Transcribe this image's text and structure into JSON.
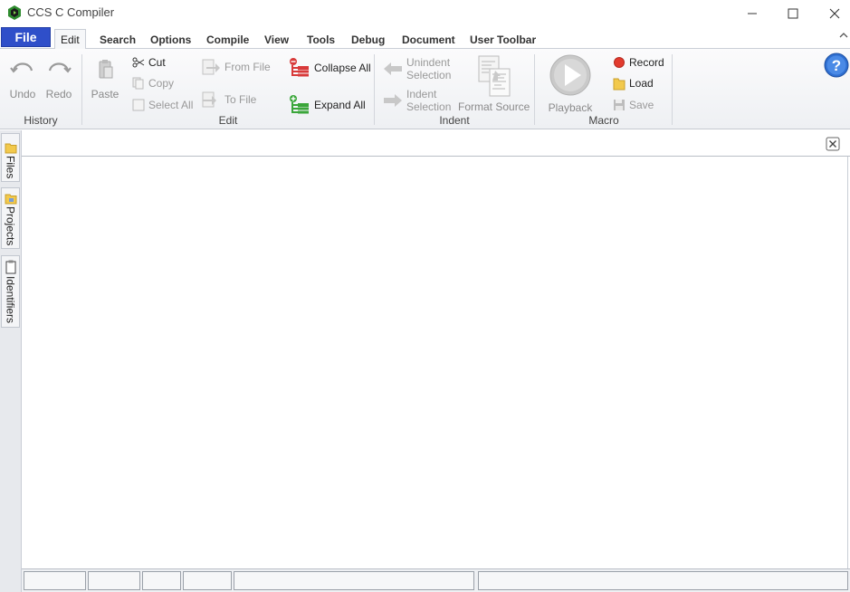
{
  "window": {
    "title": "CCS C Compiler"
  },
  "ribbon_tabs": {
    "file": "File",
    "items": [
      "Edit",
      "Search",
      "Options",
      "Compile",
      "View",
      "Tools",
      "Debug",
      "Document",
      "User Toolbar"
    ],
    "active": "Edit"
  },
  "ribbon": {
    "history": {
      "label": "History",
      "undo": "Undo",
      "redo": "Redo"
    },
    "edit": {
      "label": "Edit",
      "paste": "Paste",
      "cut": "Cut",
      "copy": "Copy",
      "select_all": "Select All",
      "from_file": "From File",
      "to_file": "To File",
      "collapse_all": "Collapse All",
      "expand_all": "Expand All"
    },
    "indent": {
      "label": "Indent",
      "unindent_line1": "Unindent",
      "unindent_line2": "Selection",
      "indent_line1": "Indent",
      "indent_line2": "Selection",
      "format_source": "Format Source"
    },
    "macro": {
      "label": "Macro",
      "playback": "Playback",
      "record": "Record",
      "load": "Load",
      "save": "Save"
    }
  },
  "dock": {
    "files": "Files",
    "projects": "Projects",
    "identifiers": "Identifiers"
  },
  "statusbar": {
    "cells": [
      "",
      "",
      "",
      "",
      "",
      ""
    ]
  },
  "colors": {
    "file_tab": "#2f4fc9",
    "record_dot": "#e23b2e",
    "collapse_icon": "#d83a3a",
    "expand_icon": "#3aa63a",
    "help_icon": "#2f6fd1"
  }
}
